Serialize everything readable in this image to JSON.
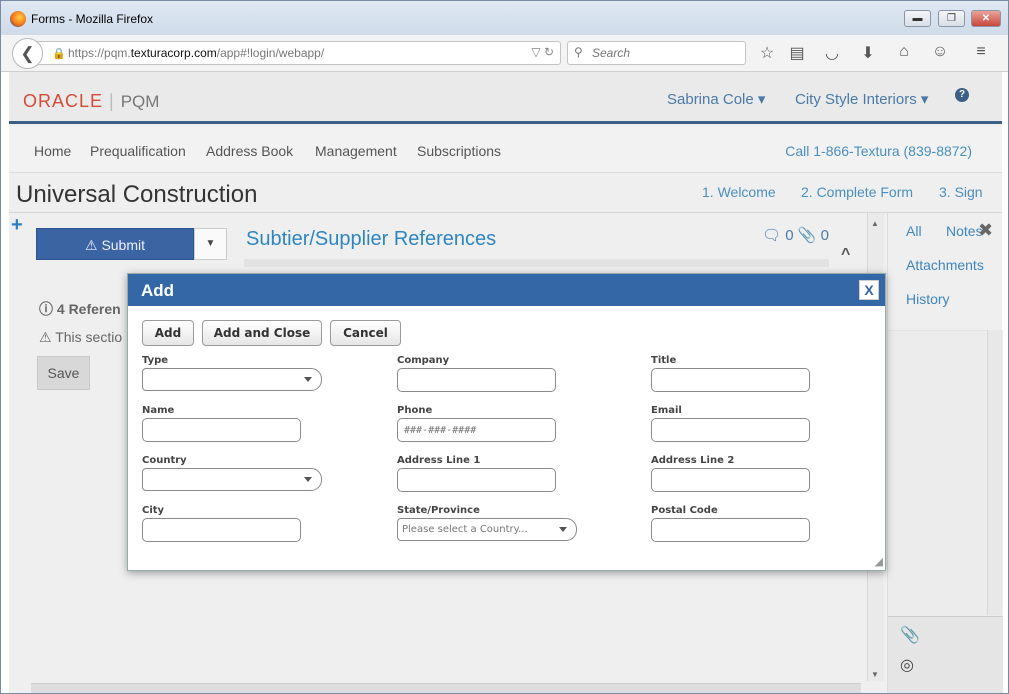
{
  "window": {
    "title": "Forms - Mozilla Firefox",
    "min": "▬",
    "max": "❐",
    "close": "✕"
  },
  "browser": {
    "url_prefix": "https://pqm.",
    "url_domain": "texturacorp.com",
    "url_suffix": "/app#!login/webapp/",
    "search_placeholder": "Search"
  },
  "header": {
    "logo": "ORACLE",
    "logo_sep": "|",
    "product": "PQM",
    "user_menu": "Sabrina Cole",
    "company_menu": "City Style Interiors",
    "help": "?"
  },
  "nav": {
    "items": [
      "Home",
      "Prequalification",
      "Address Book",
      "Management",
      "Subscriptions"
    ],
    "phone": "Call 1-866-Textura (839-8872)"
  },
  "page": {
    "title": "Universal Construction",
    "steps": [
      "1. Welcome",
      "2. Complete Form",
      "3. Sign"
    ]
  },
  "form": {
    "submit_label": "Submit",
    "section_title": "Subtier/Supplier References",
    "comment_count": "0",
    "attachment_count": "0",
    "references_note": "4 Referen",
    "section_note": "This sectio",
    "save_label": "Save"
  },
  "right_panel": {
    "tabs": [
      "All",
      "Notes",
      "Attachments",
      "History"
    ]
  },
  "modal": {
    "title": "Add",
    "close": "X",
    "buttons": {
      "add": "Add",
      "add_close": "Add and Close",
      "cancel": "Cancel"
    },
    "fields": {
      "type": {
        "label": "Type",
        "value": ""
      },
      "company": {
        "label": "Company",
        "value": ""
      },
      "title": {
        "label": "Title",
        "value": ""
      },
      "name": {
        "label": "Name",
        "value": ""
      },
      "phone": {
        "label": "Phone",
        "placeholder": "###-###-####"
      },
      "email": {
        "label": "Email",
        "value": ""
      },
      "country": {
        "label": "Country",
        "value": ""
      },
      "address1": {
        "label": "Address Line 1",
        "value": ""
      },
      "address2": {
        "label": "Address Line 2",
        "value": ""
      },
      "city": {
        "label": "City",
        "value": ""
      },
      "state": {
        "label": "State/Province",
        "value": "Please select a Country..."
      },
      "postal": {
        "label": "Postal Code",
        "value": ""
      }
    }
  },
  "colors": {
    "accent": "#3367a6",
    "link": "#4b8fc0",
    "oracle_red": "#d64b37"
  }
}
